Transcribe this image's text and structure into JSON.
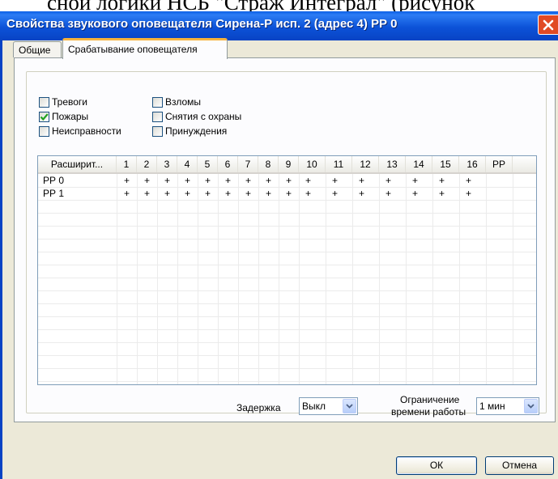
{
  "doc_top_text": "сной логики НСБ \"Страж Интеграл\" (рисунок",
  "window": {
    "title": "Свойства звукового оповещателя Сирена-Р исп. 2 (адрес 4) РР 0"
  },
  "tabs": [
    {
      "label": "Общие",
      "active": false
    },
    {
      "label": "Срабатывание оповещателя",
      "active": true
    }
  ],
  "checkboxes": [
    {
      "label": "Тревоги",
      "checked": false
    },
    {
      "label": "Пожары",
      "checked": true
    },
    {
      "label": "Неисправности",
      "checked": false
    },
    {
      "label": "Взломы",
      "checked": false
    },
    {
      "label": "Снятия с охраны",
      "checked": false
    },
    {
      "label": "Принуждения",
      "checked": false
    }
  ],
  "grid": {
    "columns": [
      "Расширит...",
      "1",
      "2",
      "3",
      "4",
      "5",
      "6",
      "7",
      "8",
      "9",
      "10",
      "11",
      "12",
      "13",
      "14",
      "15",
      "16",
      "РР"
    ],
    "rows": [
      {
        "label": "РР 0",
        "cells": [
          "+",
          "+",
          "+",
          "+",
          "+",
          "+",
          "+",
          "+",
          "+",
          "+",
          "+",
          "+",
          "+",
          "+",
          "+",
          "+",
          ""
        ]
      },
      {
        "label": "РР 1",
        "cells": [
          "+",
          "+",
          "+",
          "+",
          "+",
          "+",
          "+",
          "+",
          "+",
          "+",
          "+",
          "+",
          "+",
          "+",
          "+",
          "+",
          ""
        ]
      }
    ]
  },
  "delay": {
    "label": "Задержка",
    "value": "Выкл"
  },
  "time_limit": {
    "label_line1": "Ограничение",
    "label_line2": "времени работы",
    "value": "1 мин"
  },
  "buttons": {
    "ok": "ОК",
    "cancel": "Отмена"
  },
  "colors": {
    "title_bar": "#0c52d8",
    "close_button": "#e14a24",
    "check_mark": "#21a121",
    "active_tab_highlight": "#f7b33c"
  }
}
